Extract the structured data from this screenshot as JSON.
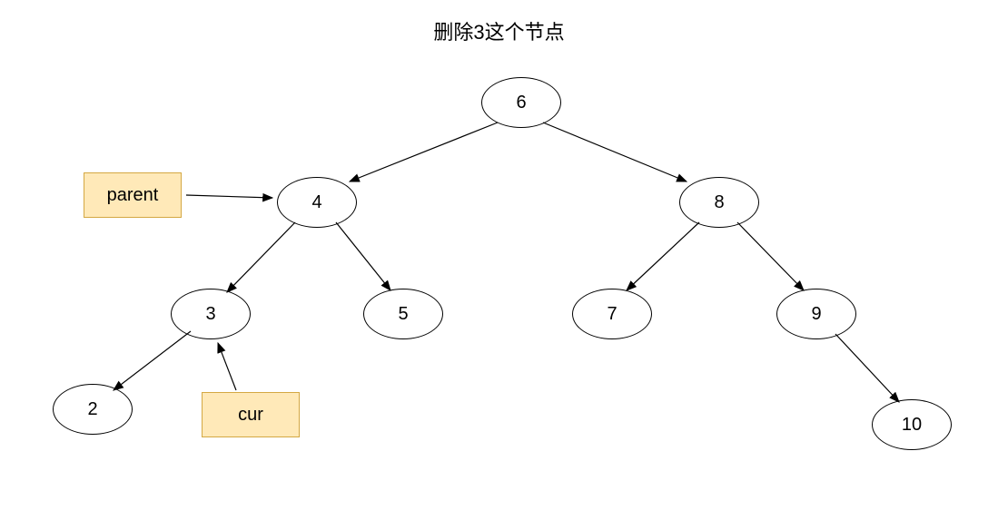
{
  "title": "删除3这个节点",
  "nodes": {
    "root": "6",
    "n4": "4",
    "n8": "8",
    "n3": "3",
    "n5": "5",
    "n7": "7",
    "n9": "9",
    "n2": "2",
    "n10": "10"
  },
  "labels": {
    "parent": "parent",
    "cur": "cur"
  },
  "chart_data": {
    "type": "tree",
    "description": "Binary search tree deletion diagram - deleting node 3",
    "structure": {
      "value": 6,
      "left": {
        "value": 4,
        "annotation": "parent",
        "left": {
          "value": 3,
          "annotation": "cur",
          "left": {
            "value": 2
          }
        },
        "right": {
          "value": 5
        }
      },
      "right": {
        "value": 8,
        "left": {
          "value": 7
        },
        "right": {
          "value": 9,
          "right": {
            "value": 10
          }
        }
      }
    }
  }
}
